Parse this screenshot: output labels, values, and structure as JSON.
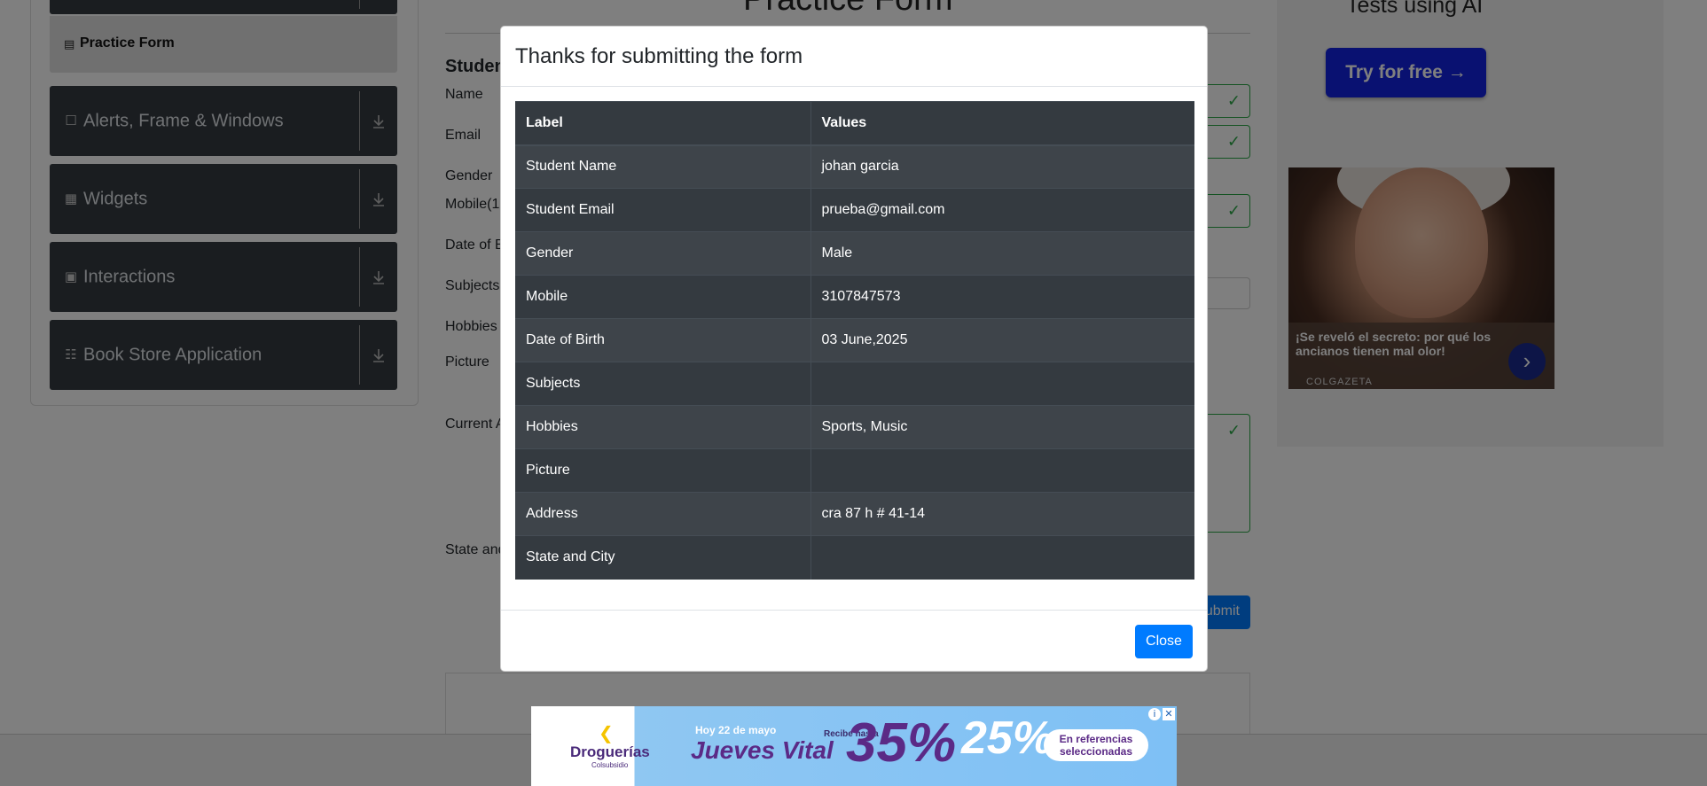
{
  "sidebar": {
    "active_item": "Practice Form",
    "groups": [
      {
        "label": "Alerts, Frame & Windows"
      },
      {
        "label": "Widgets"
      },
      {
        "label": "Interactions"
      },
      {
        "label": "Book Store Application"
      }
    ]
  },
  "form": {
    "title": "Practice Form",
    "heading": "Studen",
    "labels": {
      "name": "Name",
      "email": "Email",
      "gender": "Gender",
      "mobile": "Mobile(1(",
      "dob": "Date of B",
      "subjects": "Subjects",
      "hobbies": "Hobbies",
      "picture": "Picture",
      "address": "Current A",
      "state": "State and"
    },
    "submit_label": "ubmit"
  },
  "right_ad": {
    "title": "Tests using AI",
    "button": "Try for free →",
    "caption": "¡Se reveló el secreto: por qué los ancianos tienen mal olor!",
    "brand": "COLGAZETA"
  },
  "modal": {
    "title": "Thanks for submitting the form",
    "columns": [
      "Label",
      "Values"
    ],
    "rows": [
      {
        "label": "Student Name",
        "value": "johan garcia"
      },
      {
        "label": "Student Email",
        "value": "prueba@gmail.com"
      },
      {
        "label": "Gender",
        "value": "Male"
      },
      {
        "label": "Mobile",
        "value": "3107847573"
      },
      {
        "label": "Date of Birth",
        "value": "03 June,2025"
      },
      {
        "label": "Subjects",
        "value": ""
      },
      {
        "label": "Hobbies",
        "value": "Sports, Music"
      },
      {
        "label": "Picture",
        "value": ""
      },
      {
        "label": "Address",
        "value": "cra 87 h # 41-14"
      },
      {
        "label": "State and City",
        "value": ""
      }
    ],
    "close_label": "Close"
  },
  "banner_ad": {
    "brand": "Droguerías",
    "brand_sub": "Colsubsidio",
    "date": "Hoy 22 de mayo",
    "day": "Jueves Vital",
    "recibe": "Recibe hasta",
    "discount1": "35%",
    "discount2": "25%",
    "pill": "En referencias seleccionadas"
  },
  "colors": {
    "overlay": "#000000",
    "table_bg": "#343a40",
    "primary": "#007bff",
    "valid": "#28a745"
  }
}
